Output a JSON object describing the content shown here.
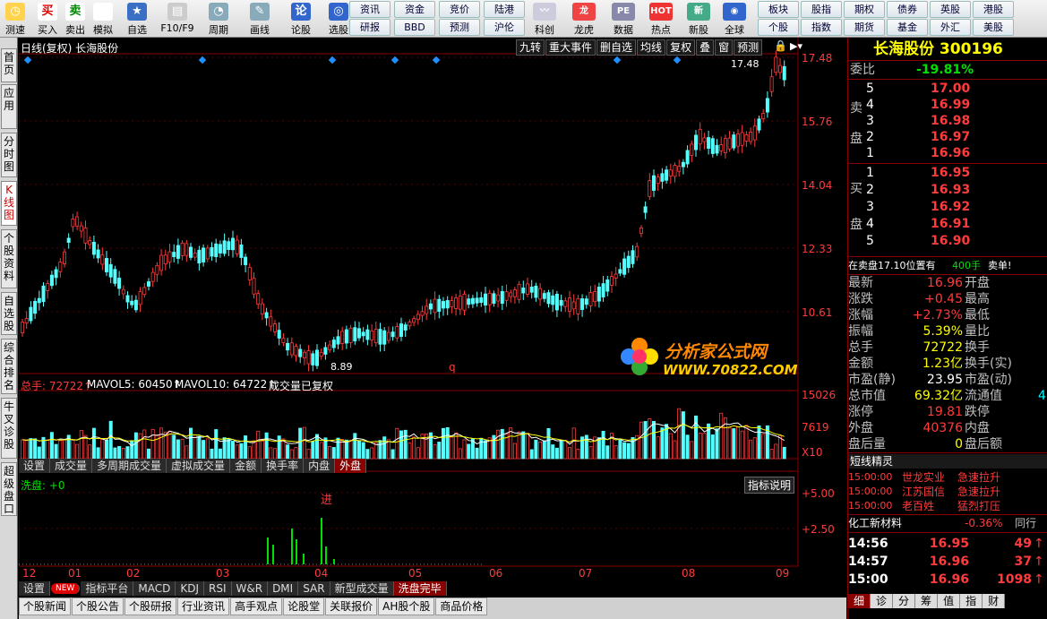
{
  "toolbar": {
    "left_buttons": [
      {
        "icon": "clock-icon",
        "label": "测速"
      },
      {
        "icon": "buy-icon",
        "glyph": "买",
        "label": "买入"
      },
      {
        "icon": "sell-icon",
        "glyph": "卖",
        "label": "卖出"
      },
      {
        "icon": "hammer-icon",
        "label": "模拟"
      },
      {
        "icon": "star-icon",
        "label": "自选"
      },
      {
        "icon": "f10-icon",
        "label": "F10/F9"
      },
      {
        "icon": "period-icon",
        "label": "周期"
      },
      {
        "icon": "pen-icon",
        "label": "画线"
      },
      {
        "icon": "forum-icon",
        "label": "论股"
      },
      {
        "icon": "select-icon",
        "label": "选股"
      }
    ],
    "grid_buttons": [
      "资讯",
      "资金",
      "竞价",
      "陆港",
      "研报",
      "BBD",
      "预测",
      "沪伦"
    ],
    "mid_buttons": [
      {
        "icon": "keyan-icon",
        "label": "科创"
      },
      {
        "icon": "dragon-icon",
        "label": "龙虎"
      },
      {
        "icon": "data-icon",
        "label": "数据"
      },
      {
        "icon": "hot-icon",
        "label": "热点"
      },
      {
        "icon": "newstock-icon",
        "label": "新股"
      },
      {
        "icon": "globe-icon",
        "label": "全球"
      }
    ],
    "right_grid": [
      "板块",
      "股指",
      "期权",
      "债券",
      "英股",
      "港股",
      "个股",
      "指数",
      "期货",
      "基金",
      "外汇",
      "美股"
    ]
  },
  "sidebar": [
    "首页",
    "应用",
    "分时图",
    "K线图",
    "个股资料",
    "自选股",
    "综合排名",
    "牛叉诊股",
    "超级盘口"
  ],
  "chart": {
    "title": "日线(复权) 长海股份",
    "buttons": [
      "九转",
      "重大事件",
      "删自选",
      "均线",
      "复权",
      "叠",
      "窗",
      "预测"
    ],
    "price_ticks": [
      "17.48",
      "15.76",
      "14.04",
      "12.33",
      "10.61"
    ],
    "high_label": "17.48",
    "low_label": "8.89",
    "vol_label": "总手: 72722↑",
    "mavol5": "MAVOL5: 60450↑",
    "mavol10": "MAVOL10: 64722↑",
    "vol_note": "成交量已复权",
    "vol_ticks": [
      "15026",
      "7619",
      "X10"
    ],
    "vol_tabs": [
      "设置",
      "成交量",
      "多周期成交量",
      "虚拟成交量",
      "金额",
      "换手率",
      "内盘",
      "外盘"
    ],
    "ind_label": "洗盘: +0",
    "ind_help": "指标说明",
    "ind_ticks": [
      "+5.00",
      "+2.50"
    ],
    "ind_mark": "进",
    "q_mark": "q",
    "months": [
      "12",
      "01",
      "02",
      "03",
      "04",
      "05",
      "06",
      "07",
      "08",
      "09"
    ],
    "ind_tabs": [
      "设置",
      "NEW",
      "指标平台",
      "MACD",
      "KDJ",
      "RSI",
      "W&R",
      "DMI",
      "SAR",
      "新型成交量",
      "洗盘完毕"
    ],
    "bottom_tabs": [
      "个股新闻",
      "个股公告",
      "个股研报",
      "行业资讯",
      "高手观点",
      "论股堂",
      "关联报价",
      "AH股个股",
      "商品价格"
    ],
    "watermark_title": "分析家公式网",
    "watermark_url": "WWW.70822.COM"
  },
  "quote": {
    "name": "长海股份 300196",
    "weibi_label": "委比",
    "weibi": "-19.81%",
    "sell_label": [
      "卖",
      "盘"
    ],
    "buy_label": [
      "买",
      "盘"
    ],
    "sells": [
      {
        "n": "5",
        "p": "17.00"
      },
      {
        "n": "4",
        "p": "16.99"
      },
      {
        "n": "3",
        "p": "16.98"
      },
      {
        "n": "2",
        "p": "16.97"
      },
      {
        "n": "1",
        "p": "16.96"
      }
    ],
    "buys": [
      {
        "n": "1",
        "p": "16.95"
      },
      {
        "n": "2",
        "p": "16.93"
      },
      {
        "n": "3",
        "p": "16.92"
      },
      {
        "n": "4",
        "p": "16.91"
      },
      {
        "n": "5",
        "p": "16.90"
      }
    ],
    "notice": "在卖盘17.10位置有",
    "notice_vol": "400手",
    "notice_tail": "卖单!",
    "stats": [
      {
        "l": "最新",
        "v": "16.96",
        "r": "开盘",
        "c": "red"
      },
      {
        "l": "涨跌",
        "v": "+0.45",
        "r": "最高",
        "c": "red"
      },
      {
        "l": "涨幅",
        "v": "+2.73%",
        "r": "最低",
        "c": "red"
      },
      {
        "l": "振幅",
        "v": "5.39%",
        "r": "量比",
        "c": "yellow"
      },
      {
        "l": "总手",
        "v": "72722",
        "r": "换手",
        "c": "yellow"
      },
      {
        "l": "金额",
        "v": "1.23亿",
        "r": "换手(实)",
        "c": "yellow"
      },
      {
        "l": "市盈(静)",
        "v": "23.95",
        "r": "市盈(动)",
        "c": "white"
      },
      {
        "l": "总市值",
        "v": "69.32亿",
        "r": "流通值",
        "c": "yellow"
      },
      {
        "l": "涨停",
        "v": "19.81",
        "r": "跌停",
        "c": "red"
      },
      {
        "l": "外盘",
        "v": "40376",
        "r": "内盘",
        "c": "red"
      },
      {
        "l": "盘后量",
        "v": "0",
        "r": "盘后额",
        "c": "yellow"
      }
    ],
    "stats_extra": "4",
    "elf_title": "短线精灵",
    "elf": [
      {
        "t": "15:00:00",
        "s": "世龙实业",
        "e": "急速拉升"
      },
      {
        "t": "15:00:00",
        "s": "江苏国信",
        "e": "急速拉升"
      },
      {
        "t": "15:00:00",
        "s": "老百姓",
        "e": "猛烈打压"
      }
    ],
    "industry": "化工新材料",
    "industry_chg": "-0.36%",
    "industry_tab": "同行",
    "ticks": [
      {
        "t": "14:56",
        "p": "16.95",
        "v": "49"
      },
      {
        "t": "14:57",
        "p": "16.96",
        "v": "37"
      },
      {
        "t": "15:00",
        "p": "16.96",
        "v": "1098"
      }
    ],
    "bottom_tabs": [
      "细",
      "诊",
      "分",
      "筹",
      "值",
      "指",
      "财"
    ]
  }
}
